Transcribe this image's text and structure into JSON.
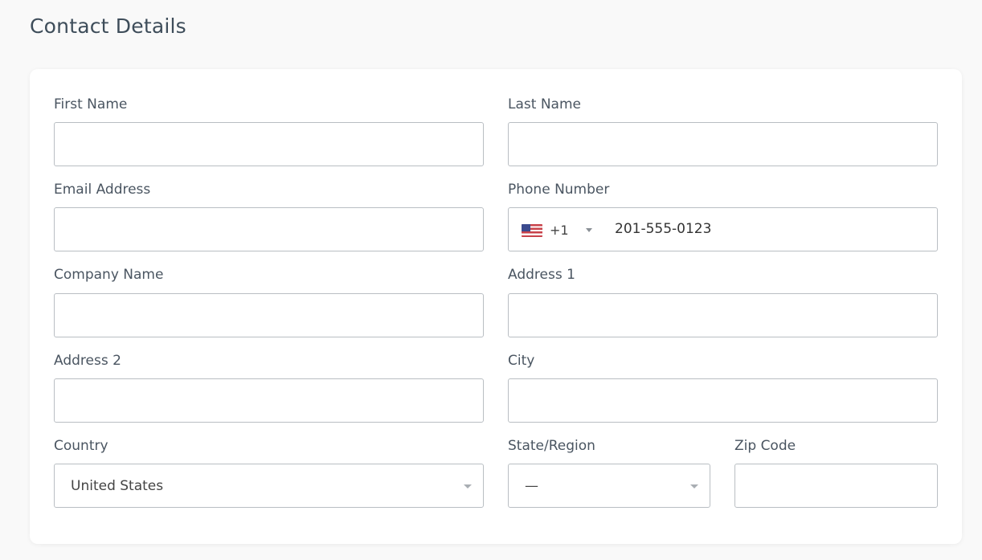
{
  "page": {
    "title": "Contact Details"
  },
  "form": {
    "first_name": {
      "label": "First Name",
      "value": ""
    },
    "last_name": {
      "label": "Last Name",
      "value": ""
    },
    "email": {
      "label": "Email Address",
      "value": ""
    },
    "phone": {
      "label": "Phone Number",
      "country_flag": "us-flag-icon",
      "dial_code": "+1",
      "value": "201-555-0123"
    },
    "company": {
      "label": "Company Name",
      "value": ""
    },
    "address1": {
      "label": "Address 1",
      "value": ""
    },
    "address2": {
      "label": "Address 2",
      "value": ""
    },
    "city": {
      "label": "City",
      "value": ""
    },
    "country": {
      "label": "Country",
      "selected": "United States"
    },
    "state": {
      "label": "State/Region",
      "selected": "—"
    },
    "zip": {
      "label": "Zip Code",
      "value": ""
    }
  }
}
